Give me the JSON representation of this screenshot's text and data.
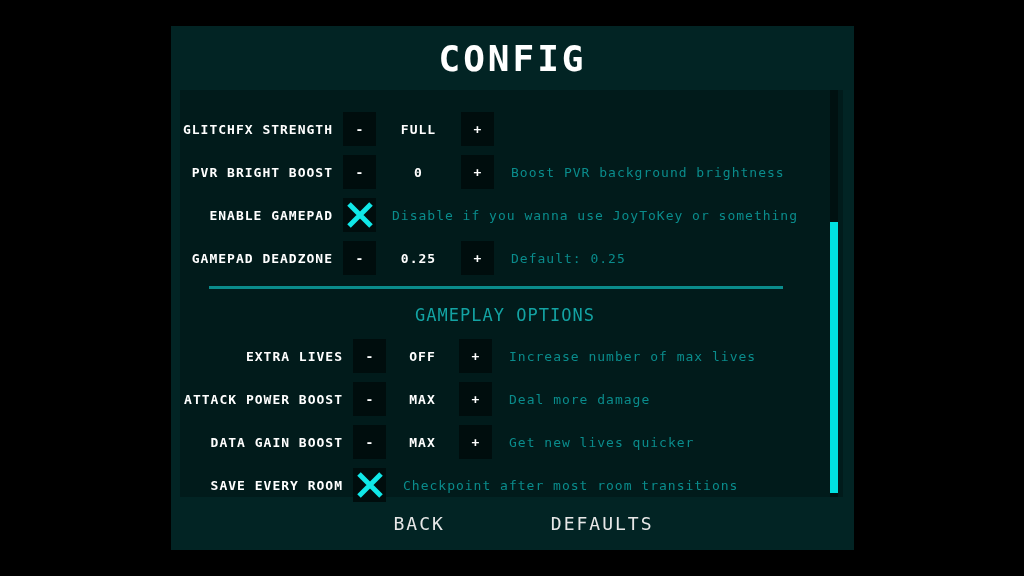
{
  "title": "CONFIG",
  "sections": [
    {
      "rows": [
        {
          "kind": "stepper",
          "label": "GLITCHFX STRENGTH",
          "minus": "-",
          "value": "FULL",
          "plus": "+"
        },
        {
          "kind": "stepper",
          "label": "PVR BRIGHT BOOST",
          "minus": "-",
          "value": "0",
          "plus": "+",
          "hint": "Boost PVR background brightness"
        },
        {
          "kind": "checkbox",
          "label": "ENABLE GAMEPAD",
          "checked": true,
          "hint": "Disable if you wanna use JoyToKey or something"
        },
        {
          "kind": "stepper",
          "label": "GAMEPAD DEADZONE",
          "minus": "-",
          "value": "0.25",
          "plus": "+",
          "hint": "Default: 0.25"
        }
      ]
    },
    {
      "heading": "GAMEPLAY OPTIONS",
      "rows": [
        {
          "kind": "stepper",
          "label": "EXTRA LIVES",
          "minus": "-",
          "value": "OFF",
          "plus": "+",
          "hint": "Increase number of max lives"
        },
        {
          "kind": "stepper",
          "label": "ATTACK POWER BOOST",
          "minus": "-",
          "value": "MAX",
          "plus": "+",
          "hint": "Deal more damage"
        },
        {
          "kind": "stepper",
          "label": "DATA GAIN BOOST",
          "minus": "-",
          "value": "MAX",
          "plus": "+",
          "hint": "Get new lives quicker"
        },
        {
          "kind": "checkbox",
          "label": "SAVE EVERY ROOM",
          "checked": true,
          "hint": "Checkpoint after most room transitions"
        }
      ]
    }
  ],
  "buttons": [
    "BACK",
    "DEFAULTS"
  ]
}
